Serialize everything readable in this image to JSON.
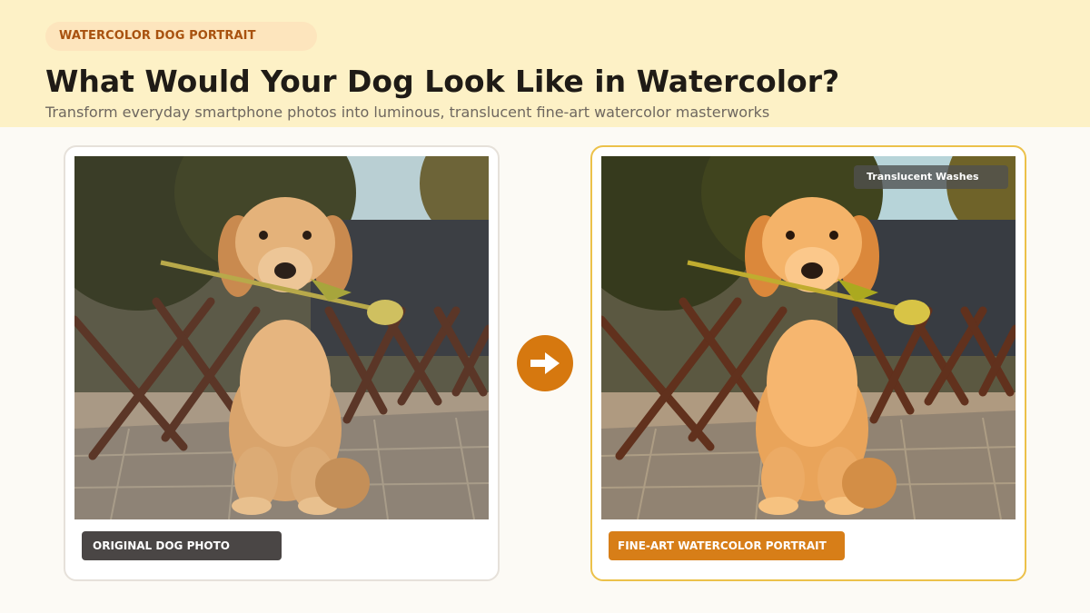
{
  "header": {
    "badge": "WATERCOLOR DOG PORTRAIT",
    "title": "What Would Your Dog Look Like in Watercolor?",
    "subtitle": "Transform everyday smartphone photos into luminous, translucent fine-art watercolor masterworks"
  },
  "original": {
    "caption": "ORIGINAL DOG PHOTO"
  },
  "result": {
    "caption": "FINE-ART WATERCOLOR PORTRAIT",
    "tag": "Translucent Washes"
  },
  "transition": {
    "icon": "arrow-right-icon"
  },
  "colors": {
    "header_bg": "#fdf1c6",
    "accent_orange": "#d6780f",
    "accent_gold_border": "#ecc14a",
    "dark_caption": "#4a4645"
  }
}
